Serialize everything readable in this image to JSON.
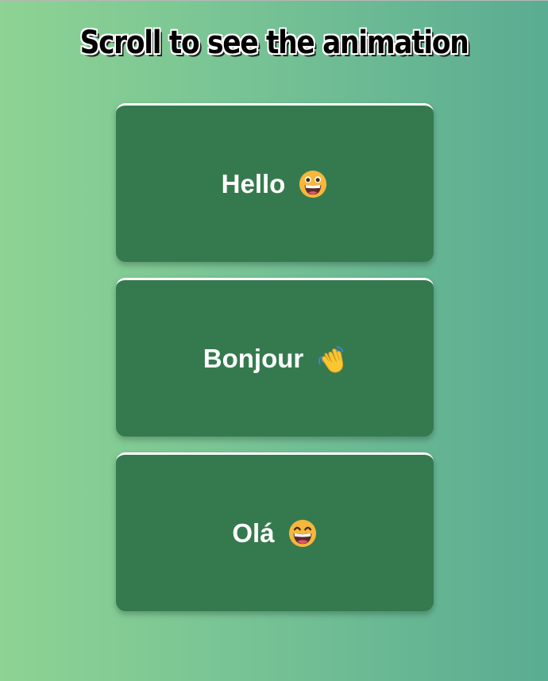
{
  "page": {
    "title": "Scroll to see the animation"
  },
  "cards": [
    {
      "label": "Hello",
      "emoji": "grinning-face-icon"
    },
    {
      "label": "Bonjour",
      "emoji": "waving-hand-icon"
    },
    {
      "label": "Olá",
      "emoji": "grinning-smiling-eyes-icon"
    }
  ],
  "colors": {
    "background_start": "#8ed393",
    "background_end": "#5aac92",
    "card": "#357a4e",
    "card_border": "#ffffff",
    "text": "#ffffff"
  }
}
